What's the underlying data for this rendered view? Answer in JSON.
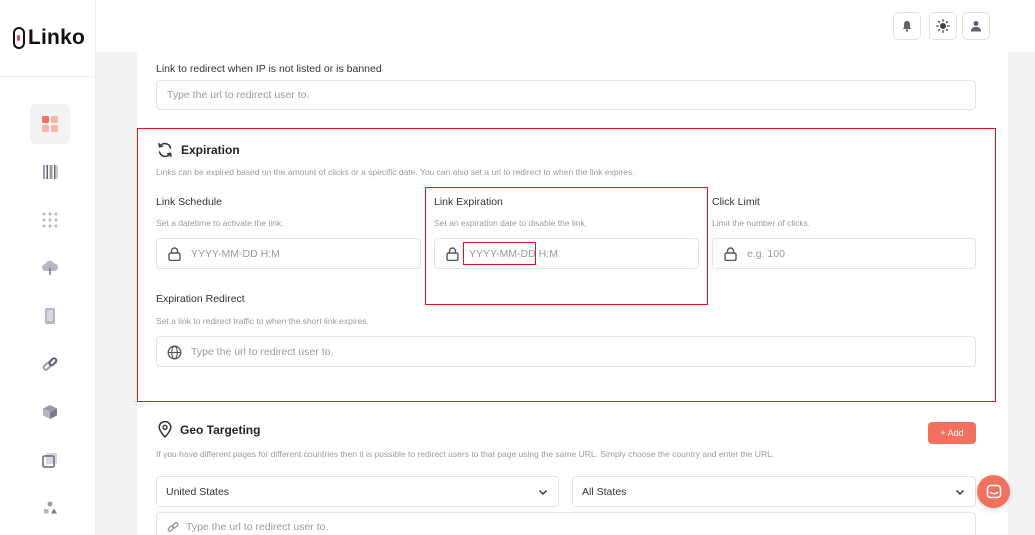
{
  "app": {
    "logo_text": "Linko"
  },
  "colors": {
    "accent": "#f2705e",
    "highlight": "#e0141c"
  },
  "sidebar": {
    "items": [
      {
        "name": "dashboard-icon",
        "active": true
      },
      {
        "name": "barcode-icon",
        "active": false
      },
      {
        "name": "grid-dots-icon",
        "active": false
      },
      {
        "name": "cloud-icon",
        "active": false
      },
      {
        "name": "phone-icon",
        "active": false
      },
      {
        "name": "link-icon",
        "active": false
      },
      {
        "name": "cube-icon",
        "active": false
      },
      {
        "name": "copy-icon",
        "active": false
      },
      {
        "name": "shapes-icon",
        "active": false
      }
    ]
  },
  "topbar": {
    "icons": [
      "bell-icon",
      "sun-icon",
      "user-icon"
    ]
  },
  "ip_redirect": {
    "label": "Link to redirect when IP is not listed or is banned",
    "placeholder": "Type the url to redirect user to."
  },
  "expiration": {
    "title": "Expiration",
    "description": "Links can be expired based on the amount of clicks or a specific date. You can also set a url to redirect to when the link expires.",
    "schedule": {
      "label": "Link Schedule",
      "help": "Set a datetime to activate the link.",
      "placeholder": "YYYY-MM-DD H:M"
    },
    "link_expiration": {
      "label": "Link Expiration",
      "help": "Set an expiration date to disable the link.",
      "placeholder_date": "YYYY-MM-DD",
      "placeholder_time": " H:M"
    },
    "click_limit": {
      "label": "Click Limit",
      "help": "Limit the number of clicks.",
      "placeholder": "e.g. 100"
    },
    "redirect": {
      "label": "Expiration Redirect",
      "help": "Set a link to redirect traffic to when the short link expires.",
      "placeholder": "Type the url to redirect user to."
    }
  },
  "geo": {
    "title": "Geo Targeting",
    "description": "If you have different pages for different countries then it is possible to redirect users to that page using the same URL. Simply choose the country and enter the URL.",
    "add_label": "+ Add",
    "country": "United States",
    "state": "All States",
    "url_placeholder": "Type the url to redirect user to."
  }
}
